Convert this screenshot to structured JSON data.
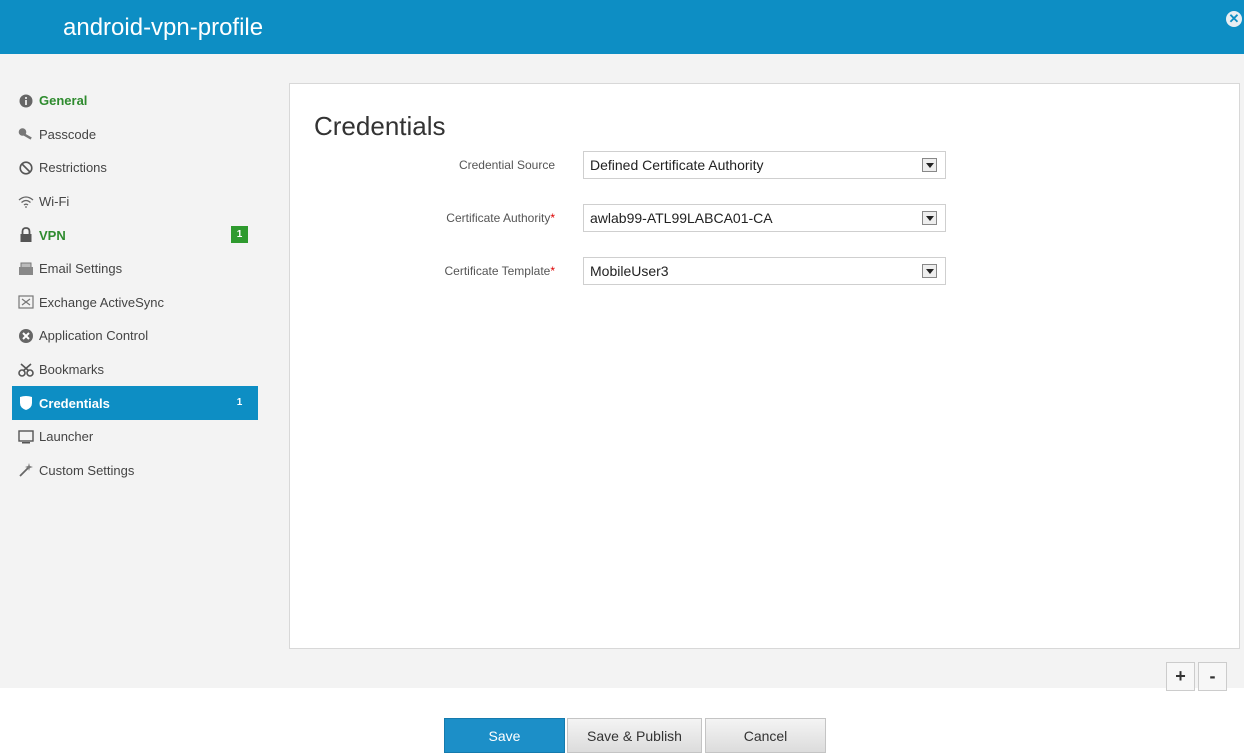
{
  "header": {
    "title": "android-vpn-profile",
    "close_icon": "close-icon"
  },
  "sidebar": {
    "items": [
      {
        "label": "General",
        "icon": "info-icon",
        "style": "green",
        "badge": ""
      },
      {
        "label": "Passcode",
        "icon": "key-icon",
        "style": "",
        "badge": ""
      },
      {
        "label": "Restrictions",
        "icon": "no-entry-icon",
        "style": "",
        "badge": ""
      },
      {
        "label": "Wi-Fi",
        "icon": "wifi-icon",
        "style": "",
        "badge": ""
      },
      {
        "label": "VPN",
        "icon": "lock-icon",
        "style": "green",
        "badge": "1"
      },
      {
        "label": "Email Settings",
        "icon": "email-icon",
        "style": "",
        "badge": ""
      },
      {
        "label": "Exchange ActiveSync",
        "icon": "sync-icon",
        "style": "",
        "badge": ""
      },
      {
        "label": "Application Control",
        "icon": "app-control-icon",
        "style": "",
        "badge": ""
      },
      {
        "label": "Bookmarks",
        "icon": "bookmark-icon",
        "style": "",
        "badge": ""
      },
      {
        "label": "Credentials",
        "icon": "shield-icon",
        "style": "active",
        "badge": "1"
      },
      {
        "label": "Launcher",
        "icon": "monitor-icon",
        "style": "",
        "badge": ""
      },
      {
        "label": "Custom Settings",
        "icon": "wand-icon",
        "style": "",
        "badge": ""
      }
    ]
  },
  "main": {
    "title": "Credentials",
    "fields": [
      {
        "label": "Credential Source",
        "required": false,
        "value": "Defined Certificate Authority"
      },
      {
        "label": "Certificate Authority",
        "required": true,
        "value": "awlab99-ATL99LABCA01-CA"
      },
      {
        "label": "Certificate Template",
        "required": true,
        "value": "MobileUser3"
      }
    ]
  },
  "controls": {
    "plus": "+",
    "minus": "-"
  },
  "footer": {
    "save": "Save",
    "publish": "Save & Publish",
    "cancel": "Cancel"
  },
  "colors": {
    "accent": "#0d8ec4",
    "green": "#2e8b2e",
    "required": "#dd0000"
  }
}
